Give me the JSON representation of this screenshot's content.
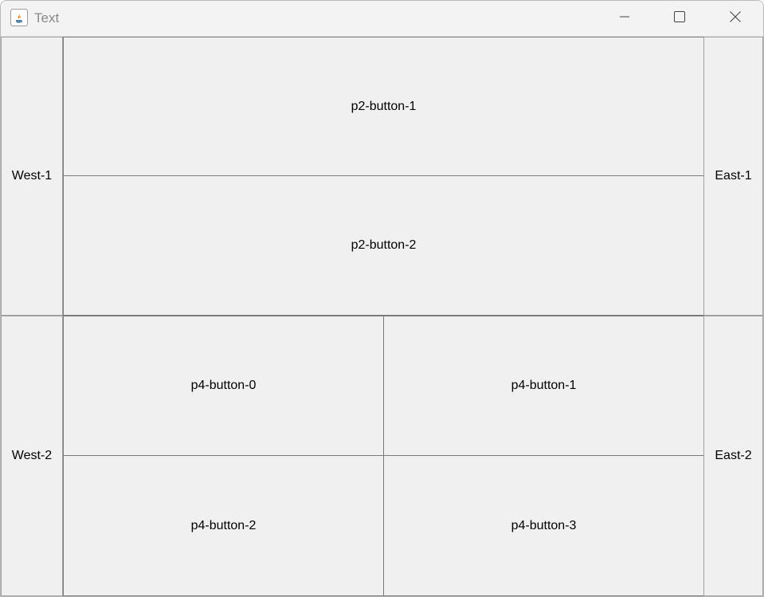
{
  "window": {
    "title": "Text",
    "icon": "java-coffee-cup-icon",
    "controls": {
      "minimize": "minimize-icon",
      "maximize": "maximize-icon",
      "close": "close-icon"
    }
  },
  "row1": {
    "west": "West-1",
    "east": "East-1",
    "buttons": [
      "p2-button-1",
      "p2-button-2"
    ]
  },
  "row2": {
    "west": "West-2",
    "east": "East-2",
    "buttons": [
      "p4-button-0",
      "p4-button-1",
      "p4-button-2",
      "p4-button-3"
    ]
  },
  "colors": {
    "panel_background": "#f0f0f0",
    "button_border": "#7a7a7a",
    "titlebar_background": "#f3f3f3"
  }
}
